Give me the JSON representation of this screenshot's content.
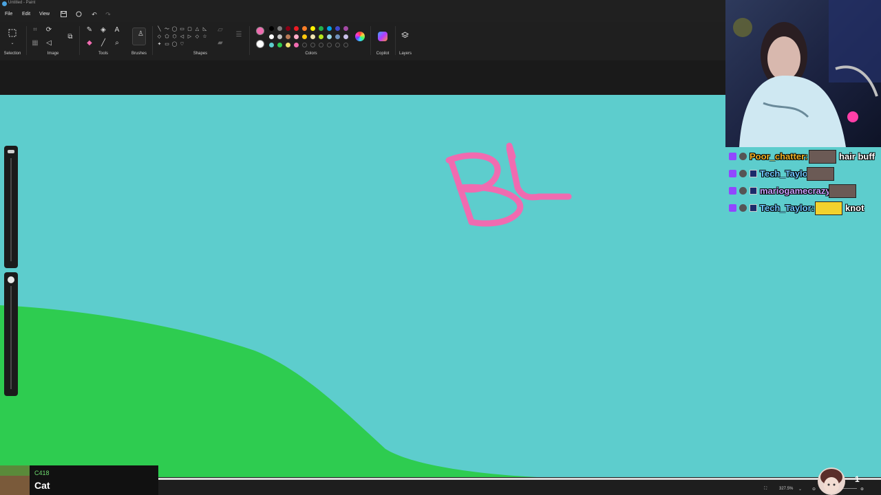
{
  "window": {
    "title": "Untitled - Paint"
  },
  "menu": {
    "file": "File",
    "edit": "Edit",
    "view": "View"
  },
  "ribbon": {
    "groups": {
      "selection": "Selection",
      "image": "Image",
      "tools": "Tools",
      "brushes": "Brushes",
      "shapes": "Shapes",
      "colors": "Colors",
      "copilot": "Copilot",
      "layers": "Layers"
    },
    "tool_letter": "A",
    "shape_glyphs": [
      "╲",
      "〜",
      "◯",
      "▭",
      "▢",
      "△",
      "◺",
      "◇",
      "⬠",
      "⬡",
      "◁",
      "▷",
      "◇",
      "☆",
      "✦",
      "▭",
      "◯",
      "♡"
    ],
    "colors": {
      "primary": "#f06bb0",
      "secondary": "#ffffff",
      "row1": [
        "#000000",
        "#7f7f7f",
        "#880015",
        "#ed1c24",
        "#ff7f27",
        "#fff200",
        "#22b14c",
        "#00a2e8",
        "#3f48cc",
        "#a349a4"
      ],
      "row2": [
        "#ffffff",
        "#c3c3c3",
        "#b97a57",
        "#ffaec9",
        "#ffc90e",
        "#efe4b0",
        "#b5e61d",
        "#99d9ea",
        "#7092be",
        "#c8bfe7"
      ],
      "row3": [
        "#5dcdcd",
        "#2ecc50",
        "#f0e070",
        "#f06bb0"
      ]
    }
  },
  "canvas": {
    "background_color": "#5dcdcd",
    "hill_color": "#2ecc50",
    "drawing_color": "#f06bb0"
  },
  "status": {
    "zoom": "327.5%"
  },
  "chat": [
    {
      "user": "Poor_chatter:",
      "user_color": "#f0b429",
      "message": "hair buff"
    },
    {
      "user": "Tech_Taylor:",
      "user_color": "#6ec6ff",
      "message": ""
    },
    {
      "user": "mariogamecrazy:",
      "user_color": "#c9a0ff",
      "message": ""
    },
    {
      "user": "Tech_Taylor:",
      "user_color": "#6ec6ff",
      "message": "knot"
    }
  ],
  "now_playing": {
    "artist": "C418",
    "title": "Cat"
  },
  "viewer_count": "1"
}
